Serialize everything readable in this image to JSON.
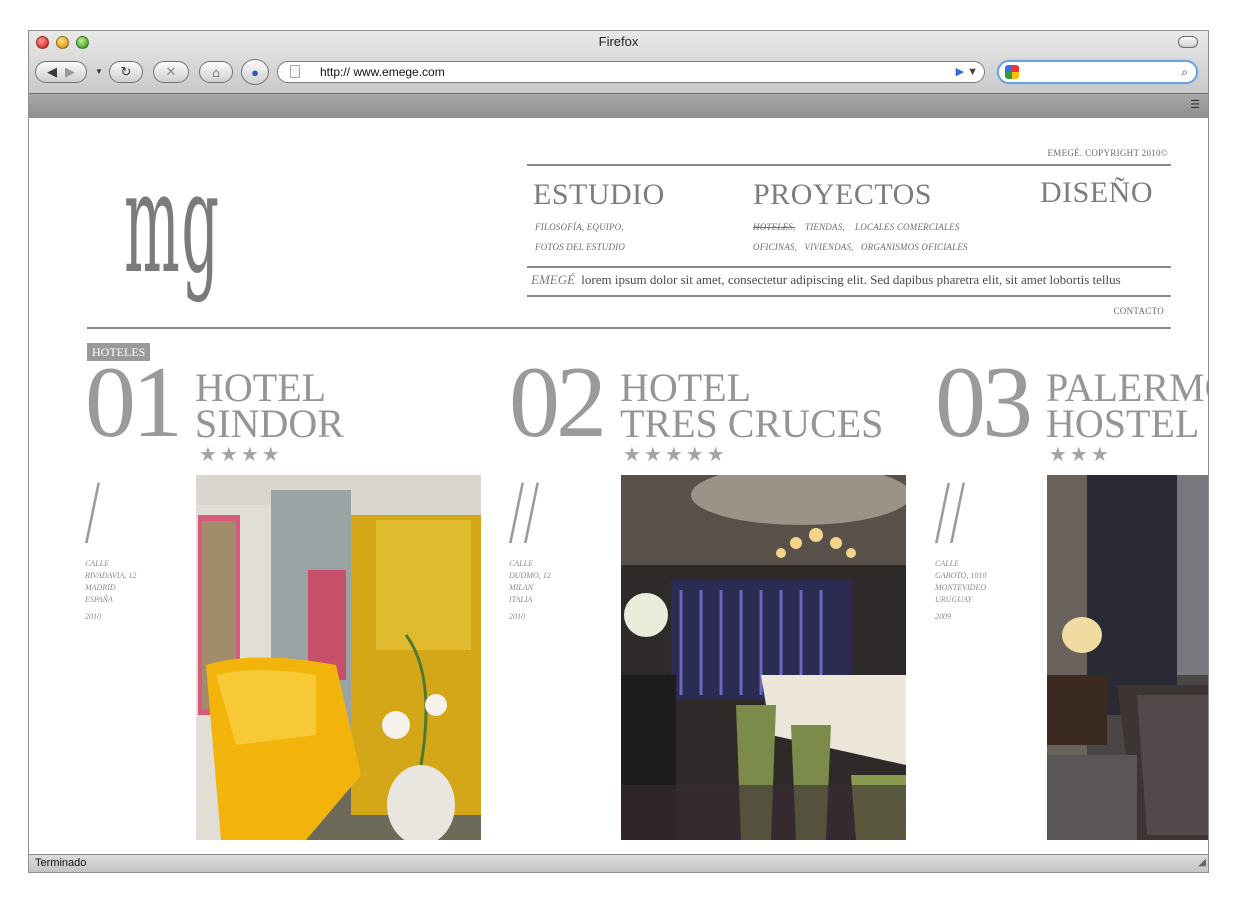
{
  "browser": {
    "title": "Firefox",
    "url": "http:// www.emege.com",
    "status": "Terminado"
  },
  "site": {
    "logo": "mg",
    "copyright": "EMEGÉ. COPYRIGHT 2010©",
    "nav": [
      {
        "title": "ESTUDIO",
        "sub1": "FILOSOFÍA, EQUIPO,",
        "sub2": "FOTOS DEL ESTUDIO"
      },
      {
        "title": "PROYECTOS",
        "sub1_items": [
          "HOTELES,",
          "TIENDAS,",
          "LOCALES COMERCIALES"
        ],
        "sub2": "OFICINAS,   VIVIENDAS,   ORGANISMOS OFICIALES"
      },
      {
        "title": "DISEÑO"
      }
    ],
    "tagline_brand": "EMEGÉ",
    "tagline_text": "lorem ipsum dolor sit amet, consectetur adipiscing elit. Sed dapibus pharetra elit, sit amet lobortis tellus",
    "contact": "CONTACTO",
    "section_badge": "HOTELES",
    "hotels": [
      {
        "num": "01",
        "line1": "HOTEL",
        "line2": "SINDOR",
        "stars": "★★★★",
        "slash": "/",
        "addr": [
          "CALLE",
          "RIVADAVIA, 12",
          "MADRID",
          "ESPAÑA"
        ],
        "year": "2010"
      },
      {
        "num": "02",
        "line1": "HOTEL",
        "line2": "TRES CRUCES",
        "stars": "★★★★★",
        "slash": "//",
        "addr": [
          "CALLE",
          "DUOMO, 12",
          "MILAN",
          "ITALIA"
        ],
        "year": "2010"
      },
      {
        "num": "03",
        "line1": "PALERMO",
        "line2": "HOSTEL",
        "stars": "★★★",
        "slash": "//",
        "addr": [
          "CALLE",
          "GABOTO, 1010",
          "MONTEVIDEO",
          "URUGUAY"
        ],
        "year": "2009"
      }
    ]
  }
}
